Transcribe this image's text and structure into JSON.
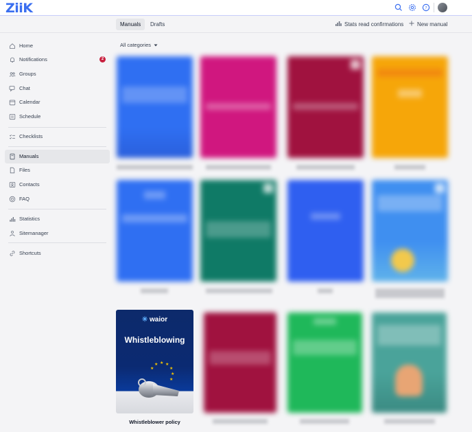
{
  "app": {
    "logo": "ZiiK"
  },
  "topbar": {
    "icons": [
      "search-icon",
      "gear-icon",
      "help-icon"
    ],
    "avatar": "avatar"
  },
  "subbar": {
    "tabs": [
      {
        "label": "Manuals",
        "active": true
      },
      {
        "label": "Drafts",
        "active": false
      }
    ],
    "stats_label": "Stats read confirmations",
    "new_label": "New manual"
  },
  "sidebar": {
    "items": [
      {
        "label": "Home",
        "icon": "home-icon"
      },
      {
        "label": "Notifications",
        "icon": "bell-icon",
        "badge": "2"
      },
      {
        "label": "Groups",
        "icon": "groups-icon"
      },
      {
        "label": "Chat",
        "icon": "chat-icon"
      },
      {
        "label": "Calendar",
        "icon": "calendar-icon"
      },
      {
        "label": "Schedule",
        "icon": "schedule-icon"
      },
      {
        "label": "Checklists",
        "icon": "checklist-icon"
      },
      {
        "label": "Manuals",
        "icon": "manual-icon",
        "active": true
      },
      {
        "label": "Files",
        "icon": "file-icon"
      },
      {
        "label": "Contacts",
        "icon": "contacts-icon"
      },
      {
        "label": "FAQ",
        "icon": "faq-icon"
      },
      {
        "label": "Statistics",
        "icon": "statistics-icon"
      },
      {
        "label": "Sitemanager",
        "icon": "sitemanager-icon"
      },
      {
        "label": "Shortcuts",
        "icon": "link-icon"
      }
    ]
  },
  "filter": {
    "label": "All categories"
  },
  "manuals": {
    "featured": {
      "brand": "waior",
      "cover_title": "Whistleblowing",
      "caption": "Whistleblower policy"
    },
    "colors": {
      "blue": "#2f6ff2",
      "magenta": "#d0177f",
      "maroon": "#a0123f",
      "orange": "#f6a609",
      "teal": "#0f7a66",
      "skyblue": "#3f8ff0",
      "green": "#1fb85a",
      "tealgray": "#4aa39a"
    }
  }
}
